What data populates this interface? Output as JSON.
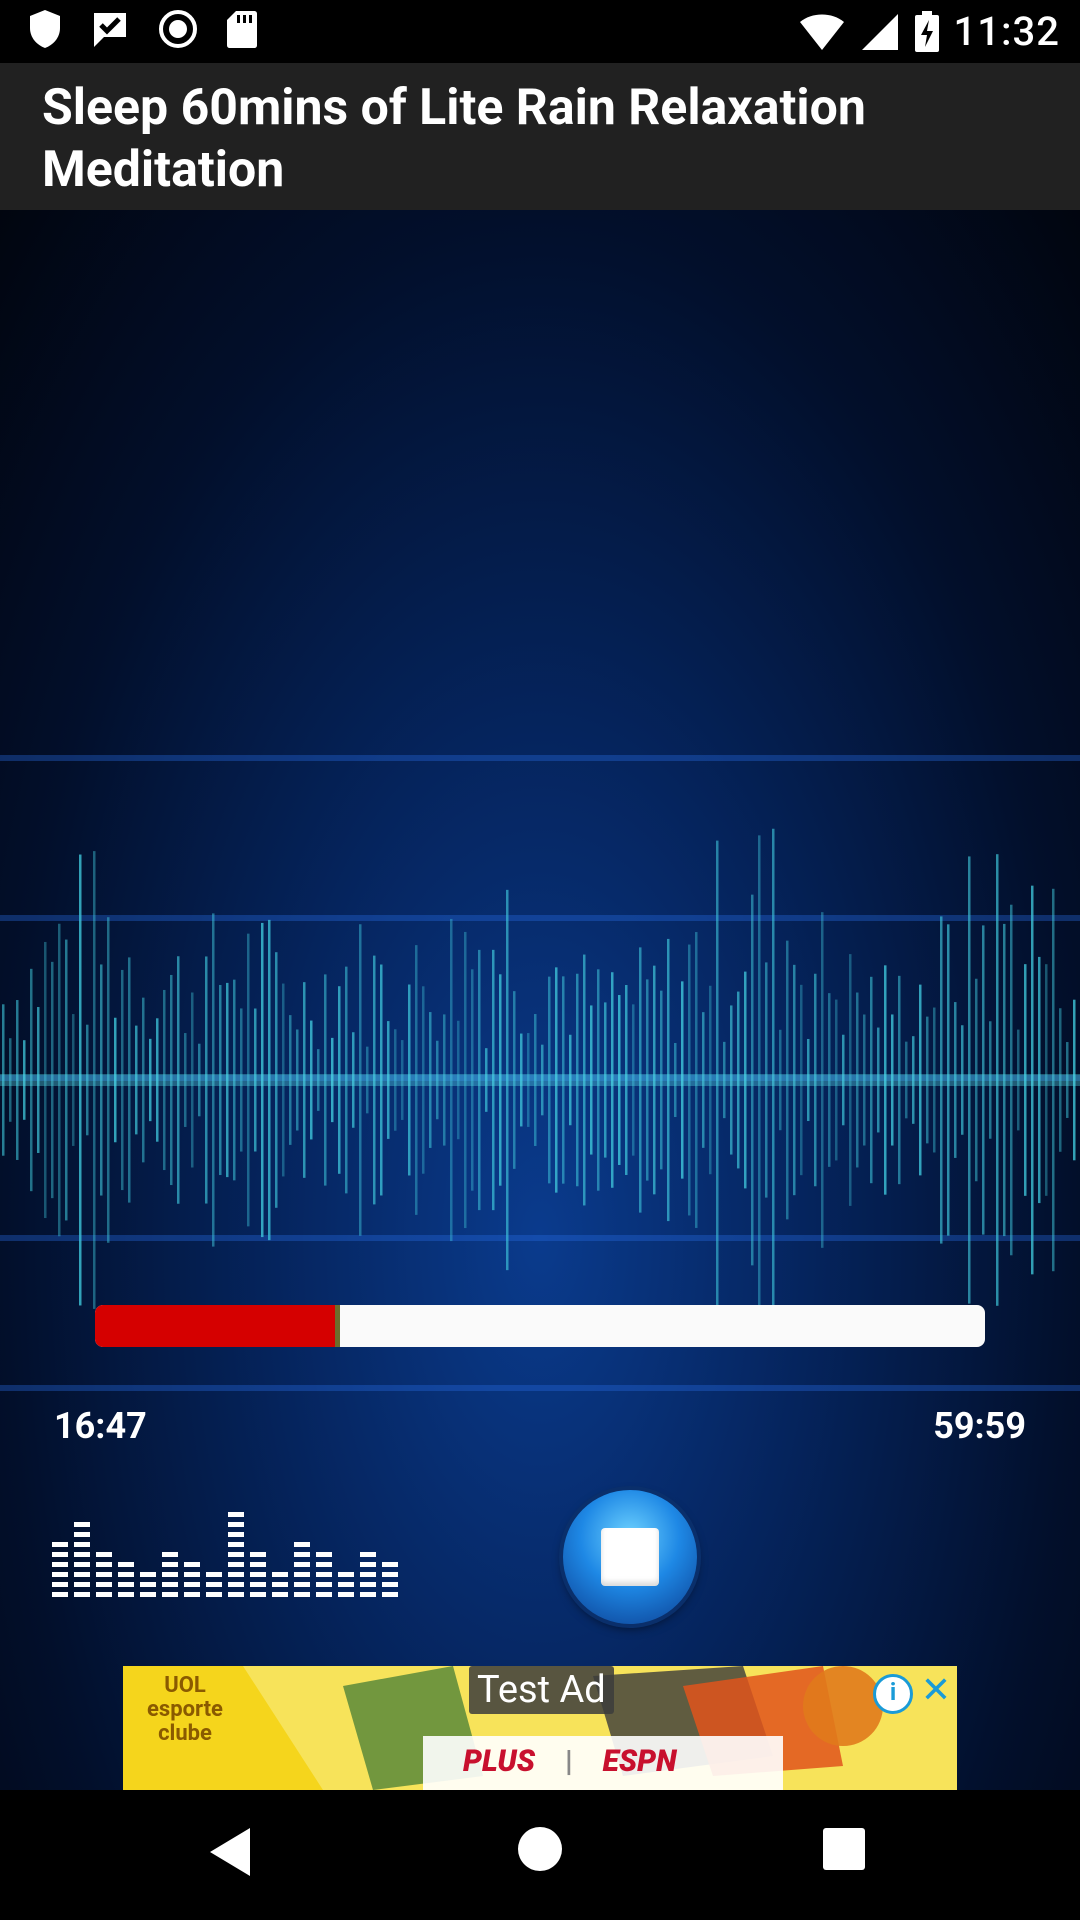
{
  "status_bar": {
    "time": "11:32",
    "left_icons": [
      "shield-icon",
      "check-message-icon",
      "record-icon",
      "sd-card-icon"
    ],
    "right_icons": [
      "wifi-icon",
      "signal-icon",
      "battery-charging-icon"
    ]
  },
  "header": {
    "title": "Sleep 60mins of Lite Rain Relaxation Meditation"
  },
  "player": {
    "elapsed": "16:47",
    "duration": "59:59",
    "progress_fraction": 0.27,
    "progress_fill_color": "#d50000",
    "track_color": "#fafafa",
    "stop_button_icon": "stop-icon"
  },
  "ad": {
    "label": "Test Ad",
    "sponsor_text": "UOL esporte clube",
    "brands": [
      "PLUS",
      "ESPN"
    ],
    "info_icon": "info-icon",
    "close_icon": "close-icon",
    "background_color": "#f5d51c"
  },
  "nav_bar": {
    "buttons": [
      "back-icon",
      "home-icon",
      "recents-icon"
    ]
  }
}
